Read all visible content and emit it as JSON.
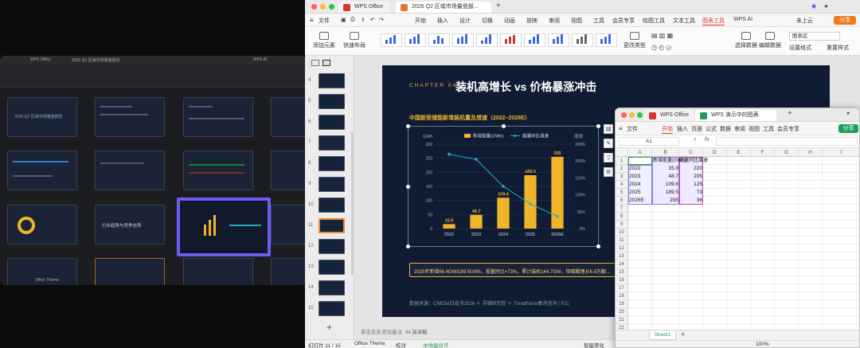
{
  "background_window": {
    "tabs": [
      "WPS Office",
      "2026 Q2 区域市场量盘报告",
      "WPS AI"
    ],
    "slide_titles": [
      "2026 Q2 区域市场量盘报告",
      "行业趋势与竞争态势"
    ],
    "status": "Office Theme"
  },
  "main": {
    "tabs": [
      {
        "label": "WPS Office",
        "color": "#d9342b"
      },
      {
        "label": "2026 Q2 区域市场量盘报...",
        "color": "#e8722c"
      }
    ],
    "menu": [
      "文件",
      "开始",
      "插入",
      "设计",
      "切换",
      "动画",
      "放映",
      "审阅",
      "视图",
      "工具",
      "会员专享",
      "绘图工具",
      "文本工具",
      "图表工具",
      "WPS AI"
    ],
    "active_menu": "图表工具",
    "top_right": {
      "cloud": "未上云",
      "share": "分享"
    },
    "ribbon": {
      "add_element": "添加元素",
      "quick_layout": "快速布局",
      "change_type": "更改类型",
      "select_data": "选择数据",
      "edit_data": "编辑数据",
      "chart_area": "图表区",
      "format_setting": "设置格式",
      "reset_style": "重置样式"
    },
    "slide_numbers": [
      "4",
      "5",
      "6",
      "7",
      "8",
      "9",
      "10",
      "11",
      "12",
      "13",
      "14",
      "15"
    ],
    "slide": {
      "chapter": "CHAPTER 04",
      "heading": "装机高增长 vs 价格暴涨冲击",
      "chart_title": "中国新型储能新增装机量及增速（2022–2026E）",
      "note": "2025年新增66.4GW/189.5GWh，规量同比+73%，累计装机144.7GW，但碳酸锂从6.8万翻...",
      "source": "数据来源：CNESA白皮书2026 ＋ 寻储研究院 ＋ TrendForce集邦咨询 | P11"
    },
    "status": {
      "slide": "幻灯片 11 / 15",
      "theme": "Office Theme",
      "proof": "校对",
      "local_backup": "本地备份开",
      "beautify": "智能美化",
      "notes": "单击此处添加备注",
      "ai_notes": "AI 演讲稿"
    }
  },
  "chart_data": {
    "type": "bar",
    "title": "中国新型储能新增装机量及增速（2022–2026E）",
    "categories": [
      "2022",
      "2023",
      "2024",
      "2025",
      "2026E"
    ],
    "series": [
      {
        "name": "新增能量(GWh)",
        "values": [
          15.9,
          48.7,
          109.6,
          189.5,
          255
        ],
        "type": "bar",
        "color": "#f0b429"
      },
      {
        "name": "能量同比增速",
        "values": [
          220,
          205,
          125,
          73,
          36
        ],
        "type": "line",
        "axis": "right",
        "color": "#2aa7c9"
      }
    ],
    "ylabel": "GWh",
    "y2label": "增速",
    "ylim": [
      0,
      300
    ],
    "y2lim": [
      0,
      250
    ],
    "yticks": [
      "0",
      "50",
      "100",
      "150",
      "200",
      "250",
      "300"
    ],
    "y2ticks": [
      "0%",
      "50%",
      "100%",
      "150%",
      "200%",
      "250%"
    ],
    "data_labels": [
      "15.9",
      "48.7",
      "109.6",
      "189.5",
      "255"
    ]
  },
  "sheet": {
    "tabs": [
      {
        "label": "WPS Office"
      },
      {
        "label": "WPS 演示中的图表"
      }
    ],
    "menu": [
      "文件",
      "开始",
      "插入",
      "页面",
      "公式",
      "数据",
      "审阅",
      "视图",
      "工具",
      "会员专享"
    ],
    "active_menu": "开始",
    "share": "分享",
    "cell_ref": "A1",
    "fx": "fx",
    "columns": [
      "A",
      "B",
      "C",
      "D",
      "E",
      "F",
      "G",
      "H",
      "I"
    ],
    "headers": [
      "",
      "新增能量(GWh)",
      "能量同比增速"
    ],
    "rows": [
      [
        "2022",
        "15.9",
        "220"
      ],
      [
        "2023",
        "48.7",
        "205"
      ],
      [
        "2024",
        "109.6",
        "125"
      ],
      [
        "2025",
        "189.5",
        "73"
      ],
      [
        "2026E",
        "255",
        "36"
      ]
    ],
    "sheet_tab": "Sheet1",
    "zoom": "100%"
  }
}
